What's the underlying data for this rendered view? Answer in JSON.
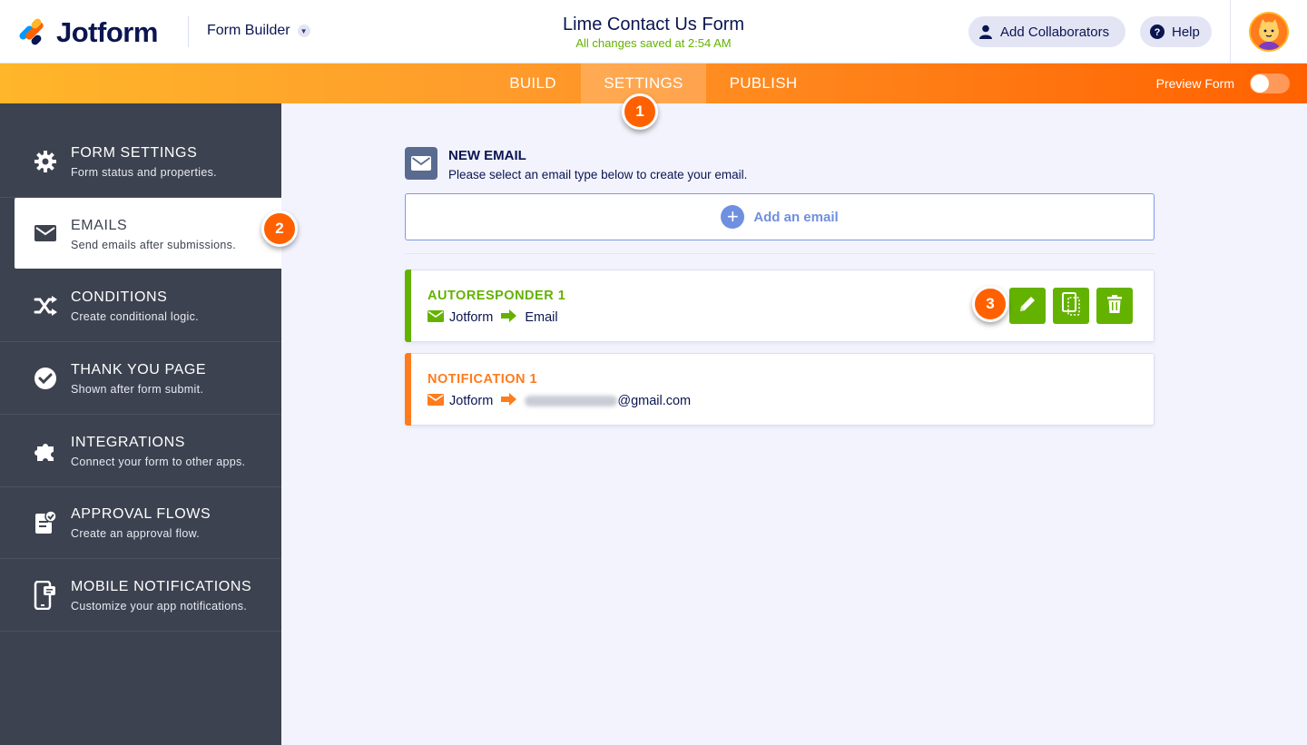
{
  "header": {
    "logo_text": "Jotform",
    "builder_label": "Form Builder",
    "form_title": "Lime Contact Us Form",
    "saved_status": "All changes saved at 2:54 AM",
    "collaborators_label": "Add Collaborators",
    "help_label": "Help"
  },
  "nav": {
    "tabs": [
      {
        "label": "BUILD"
      },
      {
        "label": "SETTINGS"
      },
      {
        "label": "PUBLISH"
      }
    ],
    "active_tab": "SETTINGS",
    "preview_label": "Preview Form",
    "preview_on": false
  },
  "sidebar": {
    "items": [
      {
        "title": "FORM SETTINGS",
        "desc": "Form status and properties.",
        "icon": "gear-icon"
      },
      {
        "title": "EMAILS",
        "desc": "Send emails after submissions.",
        "icon": "envelope-icon"
      },
      {
        "title": "CONDITIONS",
        "desc": "Create conditional logic.",
        "icon": "shuffle-icon"
      },
      {
        "title": "THANK YOU PAGE",
        "desc": "Shown after form submit.",
        "icon": "check-circle-icon"
      },
      {
        "title": "INTEGRATIONS",
        "desc": "Connect your form to other apps.",
        "icon": "puzzle-icon"
      },
      {
        "title": "APPROVAL FLOWS",
        "desc": "Create an approval flow.",
        "icon": "approval-icon"
      },
      {
        "title": "MOBILE NOTIFICATIONS",
        "desc": "Customize your app notifications.",
        "icon": "mobile-icon"
      }
    ],
    "active": "EMAILS"
  },
  "main": {
    "new_email_title": "NEW EMAIL",
    "new_email_desc": "Please select an email type below to create your email.",
    "add_email_label": "Add an email",
    "emails": [
      {
        "title": "AUTORESPONDER 1",
        "from": "Jotform",
        "to": "Email",
        "color": "#64b200"
      },
      {
        "title": "NOTIFICATION 1",
        "from": "Jotform",
        "to": "@gmail.com",
        "color": "#ff7b1c"
      }
    ]
  },
  "badges": [
    "1",
    "2",
    "3"
  ],
  "colors": {
    "accent_orange": "#ff6100",
    "green": "#64b200",
    "sidebar_bg": "#3d4250",
    "navy": "#0a1551"
  }
}
